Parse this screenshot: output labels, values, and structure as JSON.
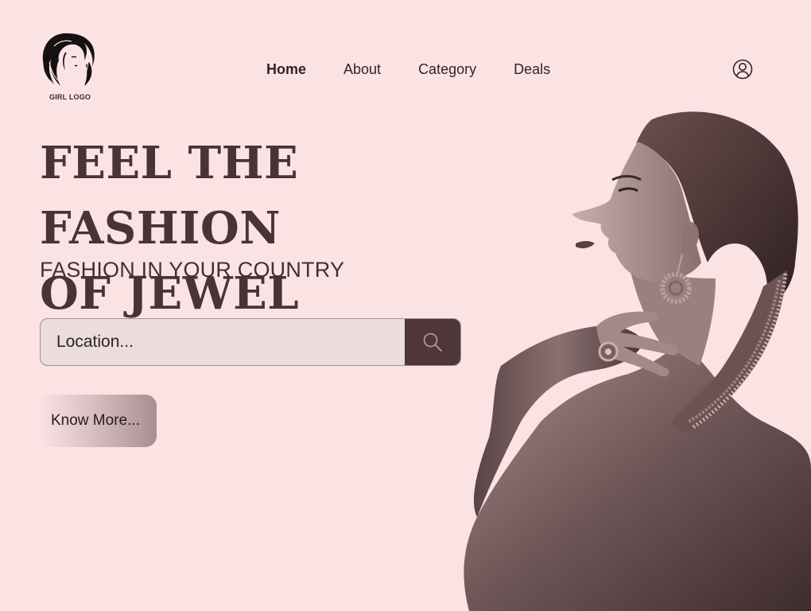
{
  "logo": {
    "text": "GIRL LOGO"
  },
  "nav": {
    "items": [
      {
        "label": "Home",
        "active": true
      },
      {
        "label": "About",
        "active": false
      },
      {
        "label": "Category",
        "active": false
      },
      {
        "label": "Deals",
        "active": false
      }
    ],
    "user_icon": "user-circle-icon"
  },
  "hero": {
    "title_line1": "FEEL THE FASHION",
    "title_line2": "OF JEWEL",
    "subtitle": "FASHION IN YOUR COUNTRY"
  },
  "search": {
    "placeholder": "Location...",
    "value": "",
    "button_icon": "search-icon"
  },
  "cta": {
    "label": "Know More..."
  },
  "colors": {
    "background": "#fbe3e4",
    "accent": "#4f3638",
    "title": "#4a3335"
  }
}
